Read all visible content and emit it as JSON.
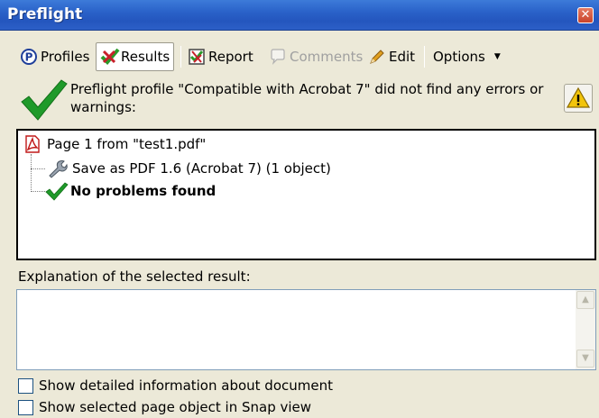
{
  "window": {
    "title": "Preflight",
    "close_glyph": "✕"
  },
  "toolbar": {
    "items": [
      {
        "label": "Profiles",
        "icon": "profiles-icon",
        "state": "normal"
      },
      {
        "label": "Results",
        "icon": "results-icon",
        "state": "active"
      },
      {
        "label": "Report",
        "icon": "report-icon",
        "state": "normal"
      },
      {
        "label": "Comments",
        "icon": "comments-icon",
        "state": "disabled"
      },
      {
        "label": "Edit",
        "icon": "pencil-icon",
        "state": "normal"
      },
      {
        "label": "Options",
        "icon": "dropdown-arrow-icon",
        "state": "normal",
        "arrow": "▼"
      }
    ]
  },
  "status": {
    "message": "Preflight profile \"Compatible with Acrobat 7\" did not find any errors or warnings:",
    "icon": "green-check-icon",
    "button_icon": "warning-icon"
  },
  "results": {
    "items": [
      {
        "label": "Page 1 from \"test1.pdf\"",
        "icon": "pdf-icon"
      },
      {
        "label": "Save as PDF 1.6 (Acrobat 7) (1 object)",
        "icon": "fixup-wrench-icon"
      },
      {
        "label": "No problems found",
        "icon": "green-check-icon"
      }
    ]
  },
  "explanation": {
    "label": "Explanation of the selected result:",
    "value": ""
  },
  "options": {
    "detailed_info": {
      "label": "Show detailed information about document",
      "checked": false
    },
    "snap_view": {
      "label": "Show selected page object in Snap view",
      "checked": false
    }
  },
  "colors": {
    "titlebar": "#2456be",
    "check_green": "#1f9a2a",
    "background": "#ece9d8"
  }
}
